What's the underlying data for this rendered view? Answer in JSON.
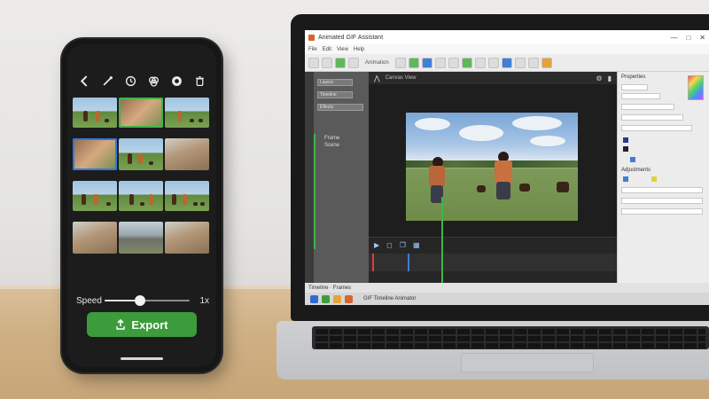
{
  "phone": {
    "toolbar": {
      "back_icon": "chevron-left-icon",
      "tools": [
        "brush-icon",
        "timer-icon",
        "filter-icon",
        "sticker-icon",
        "delete-icon"
      ]
    },
    "speed": {
      "label": "Speed",
      "value_label": "1x",
      "value_fraction": 0.42
    },
    "export_label": "Export",
    "colors": {
      "accent_green": "#3c9b3a",
      "selection_blue": "#3577e0"
    }
  },
  "laptop": {
    "window_title": "Animated GIF Assistant",
    "window_controls": [
      "—",
      "□",
      "✕"
    ],
    "menu": [
      "File",
      "Edit",
      "View",
      "Help"
    ],
    "toolbar_text": "Animation",
    "left_panel": {
      "items": [
        "Layers",
        "Timeline",
        "Effects"
      ],
      "labels": [
        "Frame",
        "Scene"
      ]
    },
    "main_header": "Canvas View",
    "status_text": "Timeline · Frames",
    "taskbar_label": "GIF Timeline Animator",
    "right_panel": {
      "title": "Properties",
      "section": "Adjustments"
    },
    "colors": {
      "timeline_marker_green": "#3fb548",
      "timeline_marker_red": "#e23b3b",
      "timeline_marker_blue": "#3f7fd4"
    }
  }
}
